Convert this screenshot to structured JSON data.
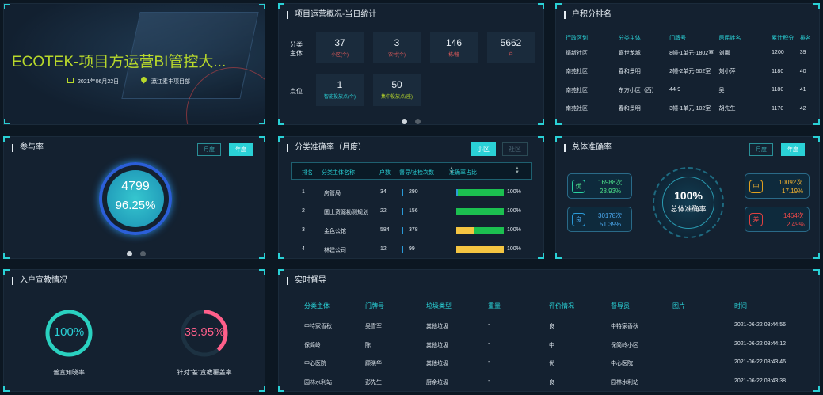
{
  "header": {
    "title": "ECOTEK-项目方运营BI管控大...",
    "date": "2021年06月22日",
    "location": "瀛江素丰项目部"
  },
  "overview": {
    "title": "项目运营概况-当日统计",
    "row1_label": "分类主体",
    "row2_label": "点位",
    "stats1": [
      {
        "value": "37",
        "unit": "小区(个)",
        "color": "#e05a5a"
      },
      {
        "value": "3",
        "unit": "农村(个)",
        "color": "#e05a5a"
      },
      {
        "value": "146",
        "unit": "栋/幢",
        "color": "#e05a5a"
      },
      {
        "value": "5662",
        "unit": "户",
        "color": "#e05a5a"
      }
    ],
    "stats2": [
      {
        "value": "1",
        "unit": "智能投放点(个)",
        "color": "#2ad1d6"
      },
      {
        "value": "50",
        "unit": "集中投放点(座)",
        "color": "#b8d82b"
      }
    ]
  },
  "ranking": {
    "title": "户积分排名",
    "headers": [
      "行政区划",
      "分类主体",
      "门牌号",
      "居民姓名",
      "累计积分",
      "排名"
    ],
    "rows": [
      [
        "缙新社区",
        "嘉世龙城",
        "8幢-1单元-1802室",
        "刘娜",
        "1200",
        "39"
      ],
      [
        "南苑社区",
        "春和景明",
        "2幢-2单元-502室",
        "刘小萍",
        "1180",
        "40"
      ],
      [
        "南苑社区",
        "东方小区（西）",
        "44-9",
        "吴",
        "1180",
        "41"
      ],
      [
        "南苑社区",
        "春和景明",
        "3幢-1单元-102室",
        "胡先生",
        "1170",
        "42"
      ]
    ]
  },
  "participation": {
    "title": "参与率",
    "btn_month": "月度",
    "btn_year": "年度",
    "count": "4799",
    "rate": "96.25%"
  },
  "accuracy": {
    "title": "分类准确率（月度）",
    "btn_a": "小区",
    "btn_b": "社区",
    "headers": [
      "排名",
      "分类主体名称",
      "户数",
      "督导/抽检次数",
      "准确率占比"
    ],
    "rows": [
      {
        "rank": "1",
        "name": "房管局",
        "households": "34",
        "checks": "290",
        "pct": "100%",
        "good": 0.96,
        "mid": 0,
        "bad": 0.04
      },
      {
        "rank": "2",
        "name": "国土资源勘测规划",
        "households": "22",
        "checks": "156",
        "pct": "100%",
        "good": 1,
        "mid": 0,
        "bad": 0
      },
      {
        "rank": "3",
        "name": "金色公馆",
        "households": "584",
        "checks": "378",
        "pct": "100%",
        "good": 0.64,
        "mid": 0.36,
        "bad": 0
      },
      {
        "rank": "4",
        "name": "林建公司",
        "households": "12",
        "checks": "99",
        "pct": "100%",
        "good": 0,
        "mid": 1,
        "bad": 0
      }
    ]
  },
  "overall": {
    "title": "总体准确率",
    "btn_month": "月度",
    "btn_year": "年度",
    "center_value": "100%",
    "center_label": "总体准确率",
    "you": {
      "label": "优",
      "count": "16988次",
      "pct": "28.93%"
    },
    "liang": {
      "label": "良",
      "count": "30178次",
      "pct": "51.39%"
    },
    "zhong": {
      "label": "中",
      "count": "10092次",
      "pct": "17.19%"
    },
    "cha": {
      "label": "差",
      "count": "1464次",
      "pct": "2.49%"
    }
  },
  "household": {
    "title": "入户宣教情况",
    "left_value": "100%",
    "left_label": "普宣知晓率",
    "right_value": "38.95%",
    "right_label": "针对“差”宣教覆盖率",
    "left_fraction": 1,
    "right_fraction": 0.3895
  },
  "realtime": {
    "title": "实时督导",
    "headers": [
      "分类主体",
      "门牌号",
      "垃圾类型",
      "重量",
      "评价情况",
      "督导员",
      "图片",
      "时间"
    ],
    "rows": [
      [
        "中特家香秋",
        "吴雪军",
        "其他垃圾",
        "-",
        "良",
        "中特家香秋",
        "",
        "2021-06-22 08:44:56"
      ],
      [
        "保简岭",
        "陈",
        "其他垃圾",
        "-",
        "中",
        "保简岭小区",
        "",
        "2021-06-22 08:44:12"
      ],
      [
        "中心医院",
        "顾晓华",
        "其他垃圾",
        "-",
        "优",
        "中心医院",
        "",
        "2021-06-22 08:43:46"
      ],
      [
        "园林水利站",
        "彭先生",
        "厨余垃圾",
        "-",
        "良",
        "园林水利站",
        "",
        "2021-06-22 08:43:38"
      ]
    ]
  }
}
